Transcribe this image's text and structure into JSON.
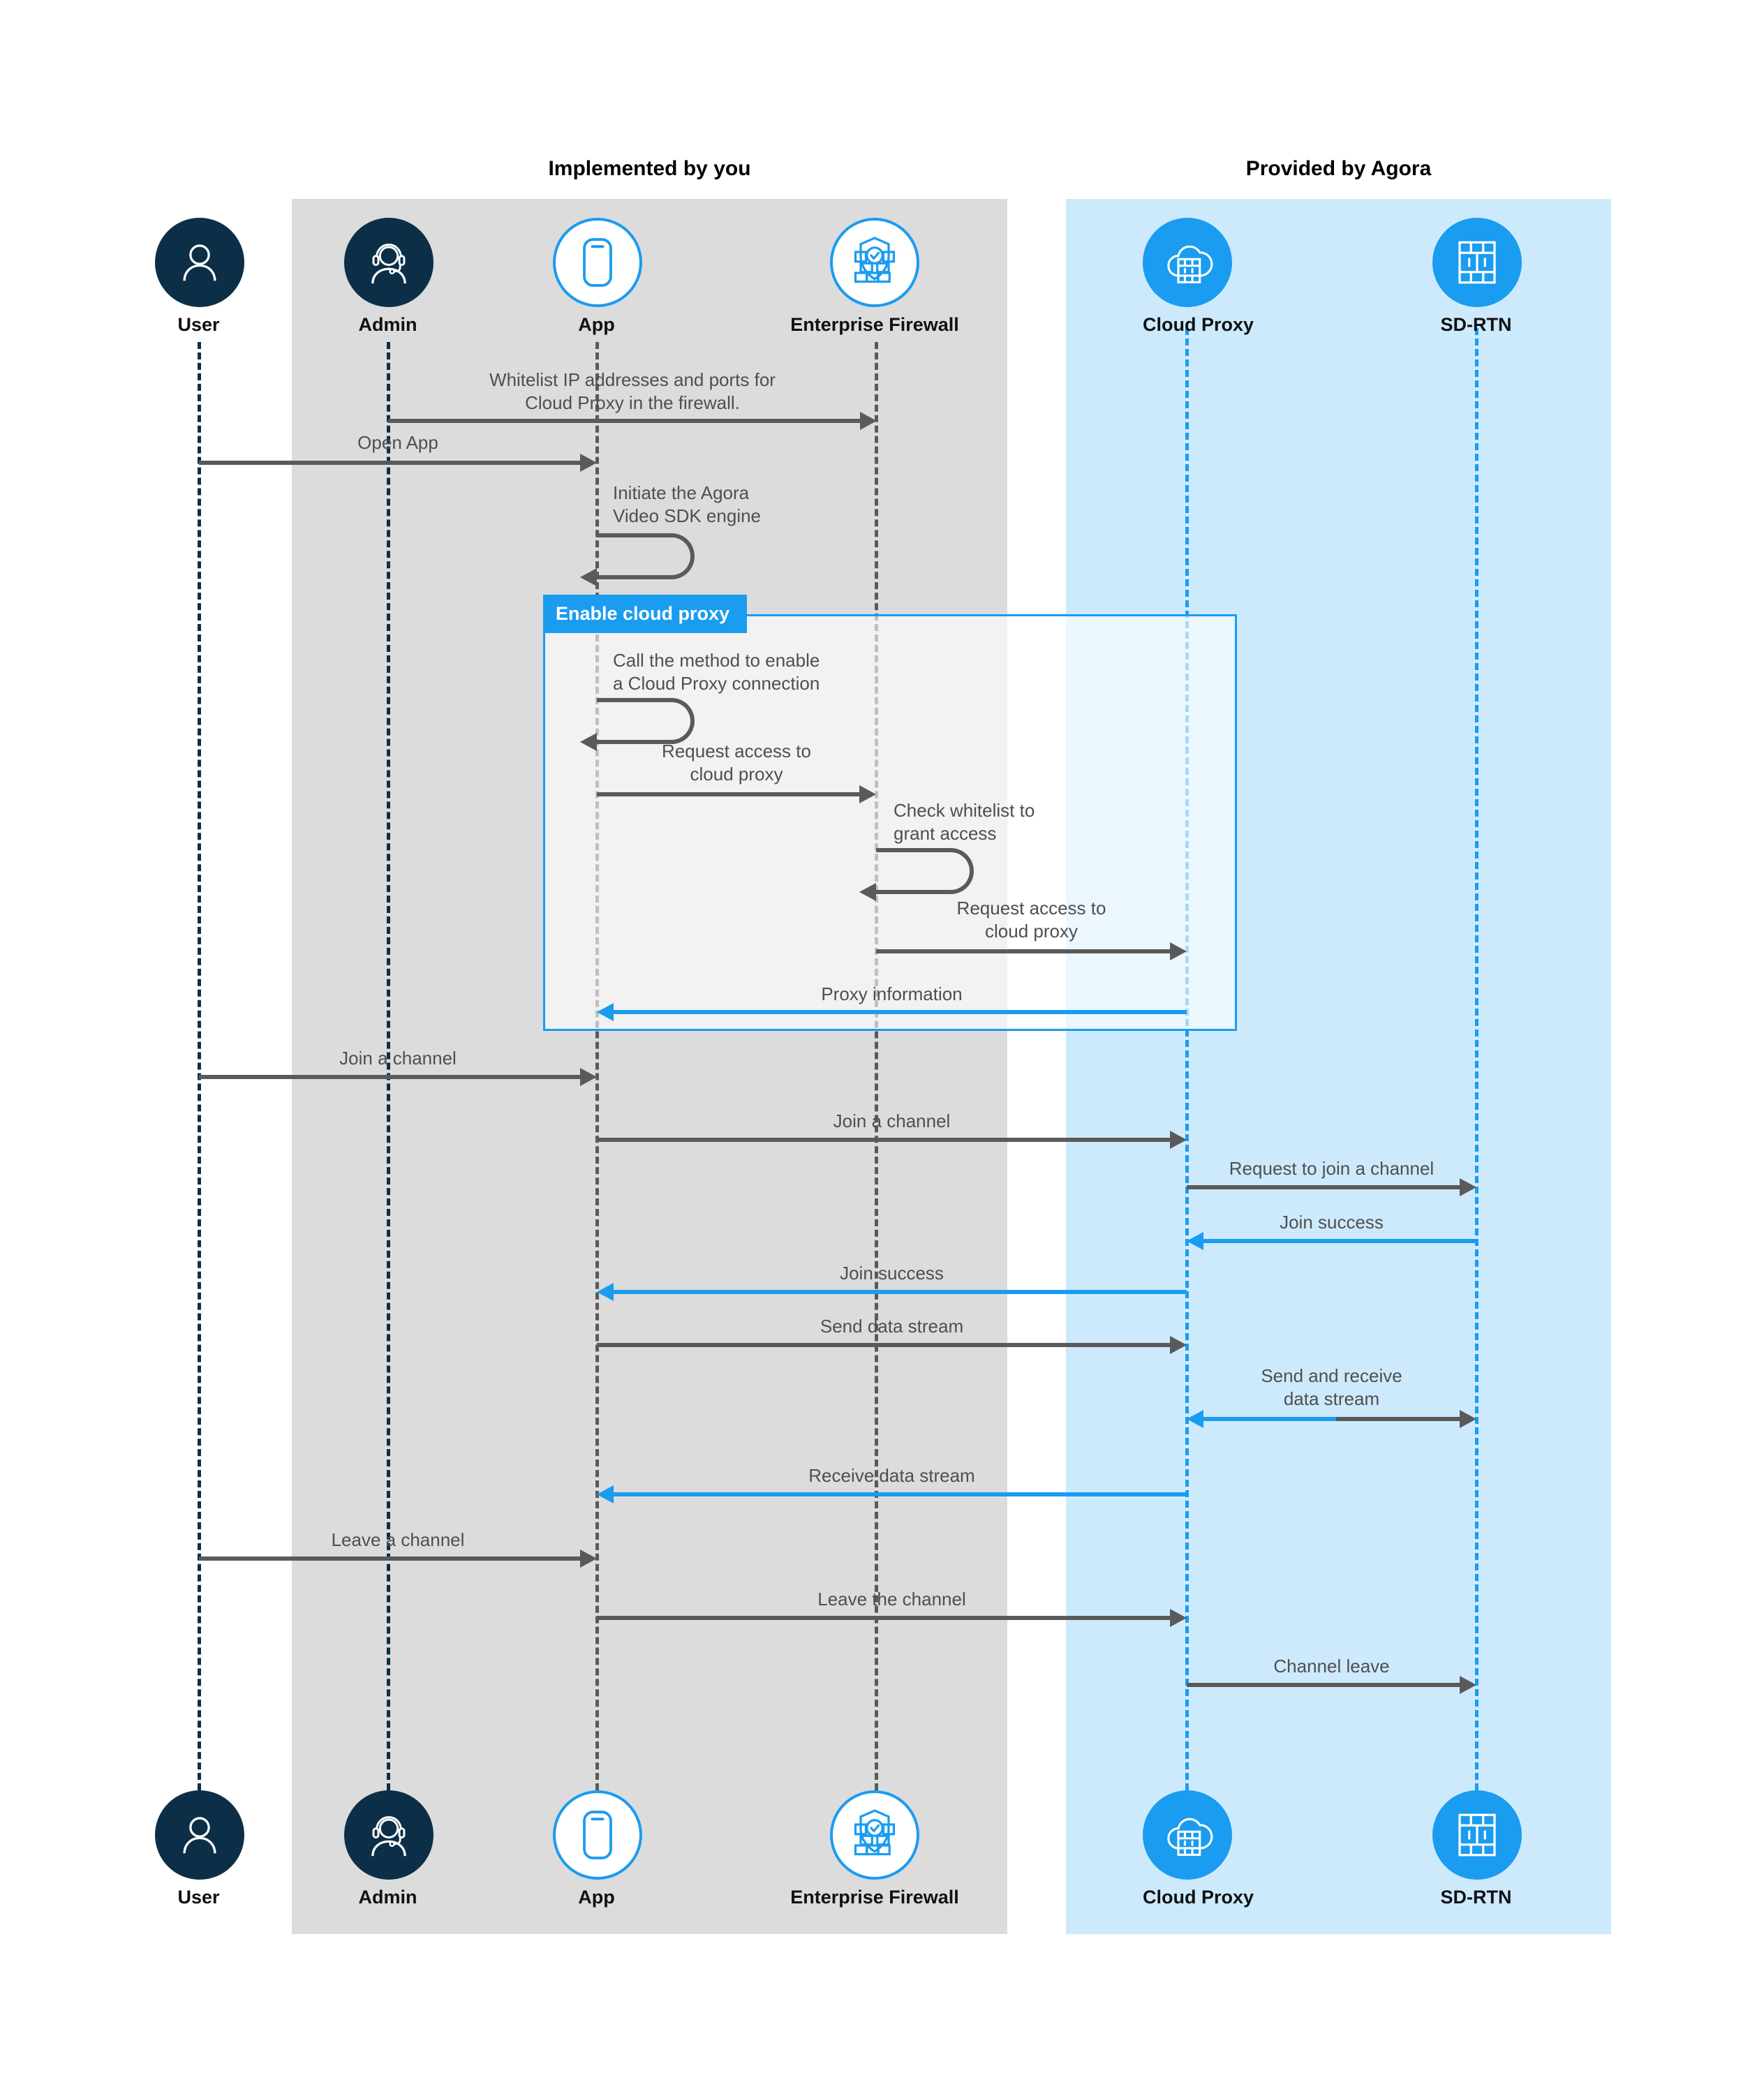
{
  "diagram": {
    "title_implemented": "Implemented by you",
    "title_provided": "Provided by Agora",
    "colors": {
      "band_gray": "#dcdcdc",
      "band_blue": "#cdeafd",
      "accent_blue": "#1a9cf0",
      "dark_navy": "#0c2f47",
      "arrow_gray": "#5a5a5a",
      "label_gray": "#4f4f4f",
      "fragment_fill": "rgba(255,255,255,0.62)"
    }
  },
  "actors": [
    {
      "id": "user",
      "label": "User",
      "icon": "user-icon",
      "style": "dark"
    },
    {
      "id": "admin",
      "label": "Admin",
      "icon": "admin-headset-icon",
      "style": "dark"
    },
    {
      "id": "app",
      "label": "App",
      "icon": "mobile-phone-icon",
      "style": "outline-blue"
    },
    {
      "id": "firewall",
      "label": "Enterprise Firewall",
      "icon": "firewall-shield-icon",
      "style": "outline-blue"
    },
    {
      "id": "proxy",
      "label": "Cloud Proxy",
      "icon": "cloud-server-icon",
      "style": "fill-blue"
    },
    {
      "id": "sdrtn",
      "label": "SD-RTN",
      "icon": "server-rack-icon",
      "style": "fill-blue"
    }
  ],
  "fragment": {
    "label": "Enable cloud proxy"
  },
  "messages": [
    {
      "id": "m1",
      "text": "Whitelist IP addresses and ports for\nCloud Proxy in the firewall.",
      "from": "admin",
      "to": "firewall",
      "color": "gray",
      "kind": "arrow"
    },
    {
      "id": "m2",
      "text": "Open App",
      "from": "user",
      "to": "app",
      "color": "gray",
      "kind": "arrow"
    },
    {
      "id": "m3",
      "text": "Initiate the Agora\nVideo SDK engine",
      "from": "app",
      "to": "app",
      "color": "gray",
      "kind": "self"
    },
    {
      "id": "m4",
      "text": "Call the method to enable\na Cloud Proxy connection",
      "from": "app",
      "to": "app",
      "color": "gray",
      "kind": "self"
    },
    {
      "id": "m5",
      "text": "Request access to\ncloud proxy",
      "from": "app",
      "to": "firewall",
      "color": "gray",
      "kind": "arrow"
    },
    {
      "id": "m6",
      "text": "Check whitelist to\ngrant access",
      "from": "firewall",
      "to": "firewall",
      "color": "gray",
      "kind": "self"
    },
    {
      "id": "m7",
      "text": "Request access to\ncloud proxy",
      "from": "firewall",
      "to": "proxy",
      "color": "gray",
      "kind": "arrow"
    },
    {
      "id": "m8",
      "text": "Proxy information",
      "from": "proxy",
      "to": "app",
      "color": "blue",
      "kind": "arrow"
    },
    {
      "id": "m9",
      "text": "Join a channel",
      "from": "user",
      "to": "app",
      "color": "gray",
      "kind": "arrow"
    },
    {
      "id": "m10",
      "text": "Join a channel",
      "from": "app",
      "to": "proxy",
      "color": "gray",
      "kind": "arrow"
    },
    {
      "id": "m11",
      "text": "Request to join a channel",
      "from": "proxy",
      "to": "sdrtn",
      "color": "gray",
      "kind": "arrow"
    },
    {
      "id": "m12",
      "text": "Join success",
      "from": "sdrtn",
      "to": "proxy",
      "color": "blue",
      "kind": "arrow"
    },
    {
      "id": "m13",
      "text": "Join success",
      "from": "proxy",
      "to": "app",
      "color": "blue",
      "kind": "arrow"
    },
    {
      "id": "m14",
      "text": "Send data stream",
      "from": "app",
      "to": "proxy",
      "color": "gray",
      "kind": "arrow"
    },
    {
      "id": "m15",
      "text": "Send and receive\ndata stream",
      "from": "proxy",
      "to": "sdrtn",
      "color": "bidi",
      "kind": "arrow"
    },
    {
      "id": "m16",
      "text": "Receive data stream",
      "from": "proxy",
      "to": "app",
      "color": "blue",
      "kind": "arrow"
    },
    {
      "id": "m17",
      "text": "Leave a channel",
      "from": "user",
      "to": "app",
      "color": "gray",
      "kind": "arrow"
    },
    {
      "id": "m18",
      "text": "Leave the channel",
      "from": "app",
      "to": "proxy",
      "color": "gray",
      "kind": "arrow"
    },
    {
      "id": "m19",
      "text": "Channel leave",
      "from": "proxy",
      "to": "sdrtn",
      "color": "gray",
      "kind": "arrow"
    }
  ]
}
